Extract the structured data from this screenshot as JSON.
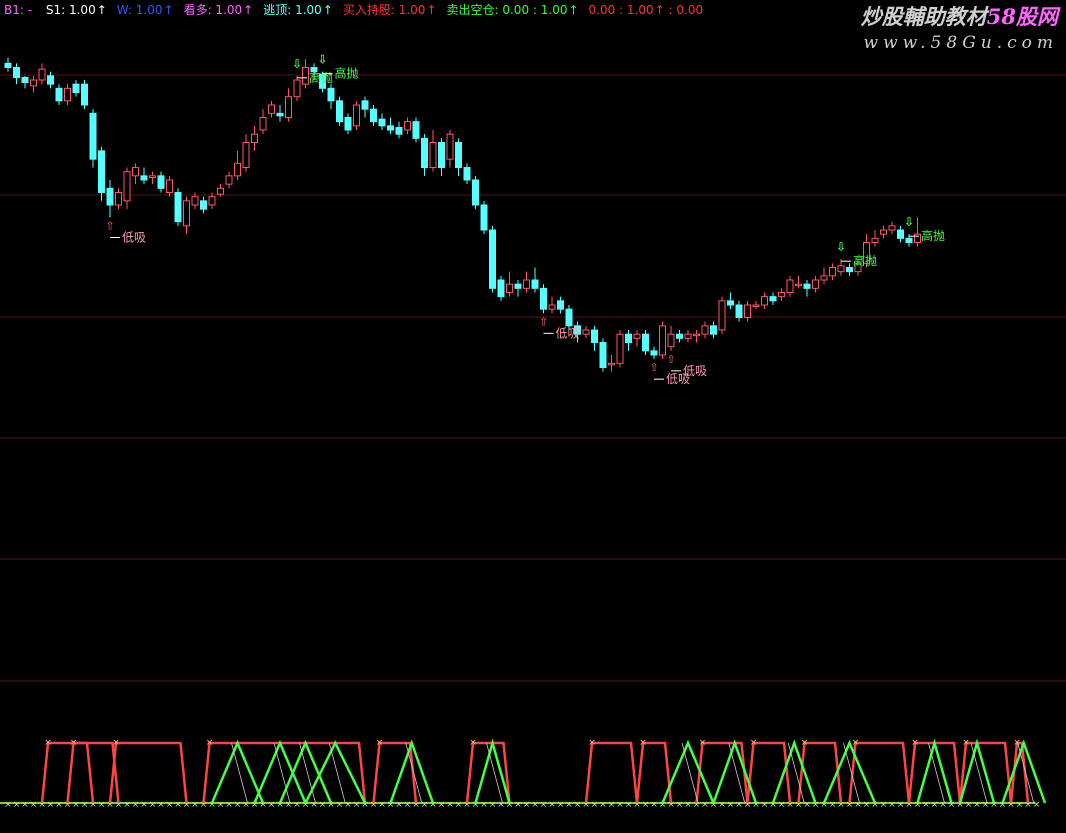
{
  "legend": [
    {
      "label": "B1: -",
      "value": "",
      "arrow": "",
      "color": "#ff66ff"
    },
    {
      "label": "S1:",
      "value": "1.00",
      "arrow": "↑",
      "color": "#ffffff"
    },
    {
      "label": "W:",
      "value": "1.00",
      "arrow": "↑",
      "color": "#3355ff"
    },
    {
      "label": "看多:",
      "value": "1.00",
      "arrow": "↑",
      "color": "#ff66ff"
    },
    {
      "label": "逃顶:",
      "value": "1.00",
      "arrow": "↑",
      "color": "#66ffff"
    },
    {
      "label": "买入持股:",
      "value": "1.00",
      "arrow": "↑",
      "color": "#ff3333"
    },
    {
      "label": "卖出空仓:",
      "value": "0.00 : 1.00",
      "arrow": "↑",
      "color": "#33ff33"
    },
    {
      "label": "",
      "value": "0.00 : 1.00",
      "arrow": "↑",
      "color": "#ff3333",
      "suffix": ": 0.00"
    }
  ],
  "watermark": {
    "title": "炒股輔助教材58股网",
    "url": "www.58Gu.com",
    "color": "#d0d0d0",
    "accent": "#ff66ff"
  },
  "colors": {
    "up": "#ff5566",
    "down": "#55ffff",
    "grid": "#5a1515",
    "buy": "#ff4444",
    "sell": "#44ff44",
    "thin": "#cccccc",
    "base": "#aaff66"
  },
  "chart_data": {
    "type": "candlestick",
    "candles": [
      [
        9.55,
        9.5,
        9.62,
        9.45
      ],
      [
        9.5,
        9.38,
        9.55,
        9.3
      ],
      [
        9.38,
        9.32,
        9.4,
        9.25
      ],
      [
        9.28,
        9.35,
        9.4,
        9.2
      ],
      [
        9.35,
        9.48,
        9.55,
        9.3
      ],
      [
        9.4,
        9.3,
        9.45,
        9.25
      ],
      [
        9.25,
        9.1,
        9.3,
        9.05
      ],
      [
        9.1,
        9.25,
        9.3,
        9.05
      ],
      [
        9.3,
        9.2,
        9.35,
        9.15
      ],
      [
        9.3,
        9.05,
        9.35,
        9.0
      ],
      [
        8.95,
        8.4,
        9.0,
        8.3
      ],
      [
        8.5,
        8.0,
        8.55,
        7.9
      ],
      [
        8.05,
        7.85,
        8.15,
        7.7
      ],
      [
        7.85,
        8.0,
        8.05,
        7.8
      ],
      [
        7.9,
        8.25,
        8.3,
        7.8
      ],
      [
        8.2,
        8.3,
        8.35,
        8.1
      ],
      [
        8.2,
        8.15,
        8.3,
        8.1
      ],
      [
        8.18,
        8.2,
        8.25,
        8.1
      ],
      [
        8.2,
        8.05,
        8.25,
        8.0
      ],
      [
        8.0,
        8.15,
        8.2,
        7.95
      ],
      [
        8.0,
        7.65,
        8.05,
        7.6
      ],
      [
        7.6,
        7.9,
        7.95,
        7.5
      ],
      [
        7.85,
        7.95,
        8.0,
        7.8
      ],
      [
        7.9,
        7.8,
        7.95,
        7.75
      ],
      [
        7.85,
        7.95,
        8.0,
        7.8
      ],
      [
        7.98,
        8.05,
        8.1,
        7.95
      ],
      [
        8.1,
        8.2,
        8.25,
        8.05
      ],
      [
        8.2,
        8.35,
        8.5,
        8.15
      ],
      [
        8.3,
        8.6,
        8.7,
        8.25
      ],
      [
        8.6,
        8.7,
        8.8,
        8.5
      ],
      [
        8.75,
        8.9,
        9.0,
        8.7
      ],
      [
        8.95,
        9.05,
        9.1,
        8.9
      ],
      [
        8.95,
        8.92,
        9.05,
        8.85
      ],
      [
        8.9,
        9.15,
        9.25,
        8.85
      ],
      [
        9.15,
        9.35,
        9.4,
        9.1
      ],
      [
        9.3,
        9.5,
        9.6,
        9.25
      ],
      [
        9.5,
        9.45,
        9.55,
        9.35
      ],
      [
        9.42,
        9.25,
        9.45,
        9.2
      ],
      [
        9.25,
        9.1,
        9.3,
        9.0
      ],
      [
        9.1,
        8.85,
        9.15,
        8.8
      ],
      [
        8.9,
        8.75,
        8.95,
        8.7
      ],
      [
        8.8,
        9.05,
        9.1,
        8.75
      ],
      [
        9.1,
        9.0,
        9.15,
        8.9
      ],
      [
        9.0,
        8.85,
        9.05,
        8.8
      ],
      [
        8.88,
        8.8,
        8.95,
        8.75
      ],
      [
        8.8,
        8.75,
        8.9,
        8.7
      ],
      [
        8.78,
        8.7,
        8.85,
        8.65
      ],
      [
        8.75,
        8.85,
        8.9,
        8.7
      ],
      [
        8.85,
        8.65,
        8.9,
        8.6
      ],
      [
        8.65,
        8.3,
        8.7,
        8.2
      ],
      [
        8.3,
        8.6,
        8.75,
        8.25
      ],
      [
        8.6,
        8.3,
        8.65,
        8.2
      ],
      [
        8.4,
        8.7,
        8.75,
        8.3
      ],
      [
        8.6,
        8.3,
        8.65,
        8.2
      ],
      [
        8.3,
        8.15,
        8.35,
        8.1
      ],
      [
        8.15,
        7.85,
        8.2,
        7.8
      ],
      [
        7.85,
        7.55,
        7.9,
        7.5
      ],
      [
        7.55,
        6.85,
        7.6,
        6.8
      ],
      [
        6.95,
        6.75,
        7.0,
        6.7
      ],
      [
        6.8,
        6.9,
        7.05,
        6.75
      ],
      [
        6.9,
        6.85,
        6.95,
        6.75
      ],
      [
        6.85,
        6.95,
        7.05,
        6.8
      ],
      [
        6.95,
        6.85,
        7.1,
        6.8
      ],
      [
        6.85,
        6.6,
        6.9,
        6.55
      ],
      [
        6.6,
        6.65,
        6.75,
        6.55
      ],
      [
        6.7,
        6.6,
        6.75,
        6.55
      ],
      [
        6.6,
        6.4,
        6.65,
        6.35
      ],
      [
        6.4,
        6.3,
        6.45,
        6.2
      ],
      [
        6.3,
        6.35,
        6.4,
        6.25
      ],
      [
        6.35,
        6.2,
        6.4,
        6.1
      ],
      [
        6.2,
        5.9,
        6.25,
        5.85
      ],
      [
        5.95,
        5.95,
        6.05,
        5.85
      ],
      [
        5.95,
        6.3,
        6.35,
        5.9
      ],
      [
        6.3,
        6.2,
        6.35,
        6.1
      ],
      [
        6.25,
        6.3,
        6.35,
        6.15
      ],
      [
        6.3,
        6.1,
        6.35,
        6.05
      ],
      [
        6.1,
        6.05,
        6.15,
        6.0
      ],
      [
        6.05,
        6.4,
        6.45,
        6.0
      ],
      [
        6.15,
        6.3,
        6.4,
        6.1
      ],
      [
        6.3,
        6.25,
        6.35,
        6.2
      ],
      [
        6.25,
        6.3,
        6.35,
        6.2
      ],
      [
        6.3,
        6.3,
        6.35,
        6.2
      ],
      [
        6.3,
        6.4,
        6.45,
        6.25
      ],
      [
        6.4,
        6.3,
        6.45,
        6.25
      ],
      [
        6.35,
        6.7,
        6.75,
        6.3
      ],
      [
        6.7,
        6.65,
        6.8,
        6.6
      ],
      [
        6.65,
        6.5,
        6.7,
        6.45
      ],
      [
        6.5,
        6.65,
        6.7,
        6.45
      ],
      [
        6.65,
        6.65,
        6.7,
        6.6
      ],
      [
        6.65,
        6.75,
        6.8,
        6.6
      ],
      [
        6.75,
        6.7,
        6.8,
        6.65
      ],
      [
        6.75,
        6.8,
        6.85,
        6.7
      ],
      [
        6.8,
        6.95,
        7.0,
        6.75
      ],
      [
        6.9,
        6.9,
        7.0,
        6.85
      ],
      [
        6.9,
        6.85,
        6.95,
        6.75
      ],
      [
        6.85,
        6.95,
        7.0,
        6.8
      ],
      [
        6.95,
        7.0,
        7.1,
        6.9
      ],
      [
        7.0,
        7.1,
        7.15,
        6.95
      ],
      [
        7.05,
        7.12,
        7.2,
        7.0
      ],
      [
        7.1,
        7.05,
        7.15,
        7.0
      ],
      [
        7.05,
        7.15,
        7.2,
        7.0
      ],
      [
        7.15,
        7.4,
        7.5,
        7.1
      ],
      [
        7.4,
        7.45,
        7.55,
        7.35
      ],
      [
        7.5,
        7.55,
        7.6,
        7.45
      ],
      [
        7.55,
        7.6,
        7.65,
        7.5
      ],
      [
        7.55,
        7.45,
        7.6,
        7.4
      ],
      [
        7.45,
        7.4,
        7.5,
        7.35
      ],
      [
        7.4,
        7.5,
        7.7,
        7.35
      ]
    ],
    "signals": [
      {
        "index": 12,
        "type": "buy",
        "label": "低吸"
      },
      {
        "index": 34,
        "type": "sell",
        "label": "高抛"
      },
      {
        "index": 37,
        "type": "sell",
        "label": "高抛"
      },
      {
        "index": 63,
        "type": "buy",
        "label": "低吸"
      },
      {
        "index": 76,
        "type": "buy",
        "label": "低吸"
      },
      {
        "index": 78,
        "type": "buy",
        "label": "低吸"
      },
      {
        "index": 98,
        "type": "sell",
        "label": "高抛"
      },
      {
        "index": 106,
        "type": "sell",
        "label": "高抛"
      }
    ],
    "indicator": {
      "red": [
        [
          4,
          10
        ],
        [
          7,
          13
        ],
        [
          12,
          21
        ],
        [
          23,
          42
        ],
        [
          43,
          48
        ],
        [
          54,
          59
        ],
        [
          68,
          74
        ],
        [
          74,
          78
        ],
        [
          81,
          87
        ],
        [
          87,
          92
        ],
        [
          93,
          98
        ],
        [
          99,
          106
        ],
        [
          106,
          112
        ],
        [
          112,
          118
        ],
        [
          118,
          120
        ]
      ],
      "green": [
        [
          24,
          30
        ],
        [
          29,
          35
        ],
        [
          32,
          38
        ],
        [
          35,
          42
        ],
        [
          45,
          50
        ],
        [
          55,
          59
        ],
        [
          77,
          83
        ],
        [
          83,
          88
        ],
        [
          90,
          95
        ],
        [
          96,
          102
        ],
        [
          107,
          111
        ],
        [
          112,
          116
        ],
        [
          117,
          122
        ]
      ]
    }
  }
}
